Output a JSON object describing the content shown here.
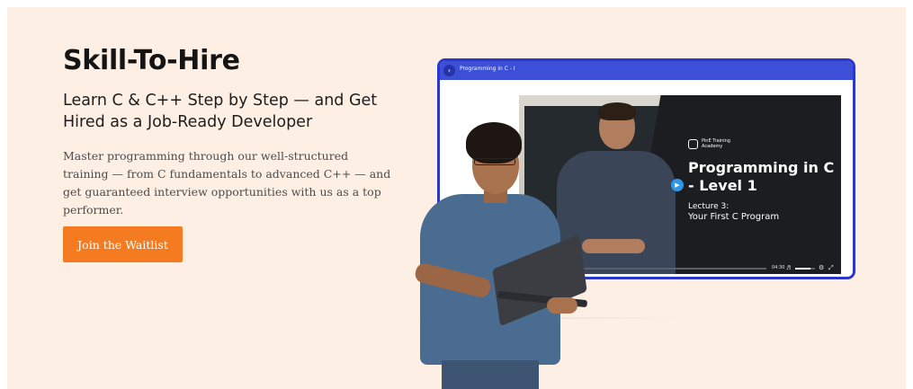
{
  "hero": {
    "title": "Skill-To-Hire",
    "subtitle": "Learn C & C++ Step by Step — and Get Hired as a Job-Ready Developer",
    "description": "Master programming through our well-structured training — from C fundamentals to advanced C++ — and get guaranteed interview opportunities with us as a top performer.",
    "cta_label": "Join the Waitlist"
  },
  "player": {
    "title": "Programming in C - I",
    "back_icon": "chevron-left-icon",
    "brand": "PinE Training Academy",
    "course_title": "Programming in C - Level 1",
    "lecture_number": "Lecture 3:",
    "lecture_name": "Your First C Program",
    "elapsed_time": "04:30",
    "progress_fraction": 0.02,
    "volume_fraction": 0.75,
    "icons": {
      "play": "play-icon",
      "volume": "volume-icon",
      "settings": "gear-icon",
      "fullscreen": "fullscreen-icon"
    }
  },
  "colors": {
    "background": "#fdefe4",
    "accent": "#f47b20",
    "player_frame": "#2a37c8",
    "player_bar": "#3d4fd6",
    "play_button": "#2f97e8"
  }
}
